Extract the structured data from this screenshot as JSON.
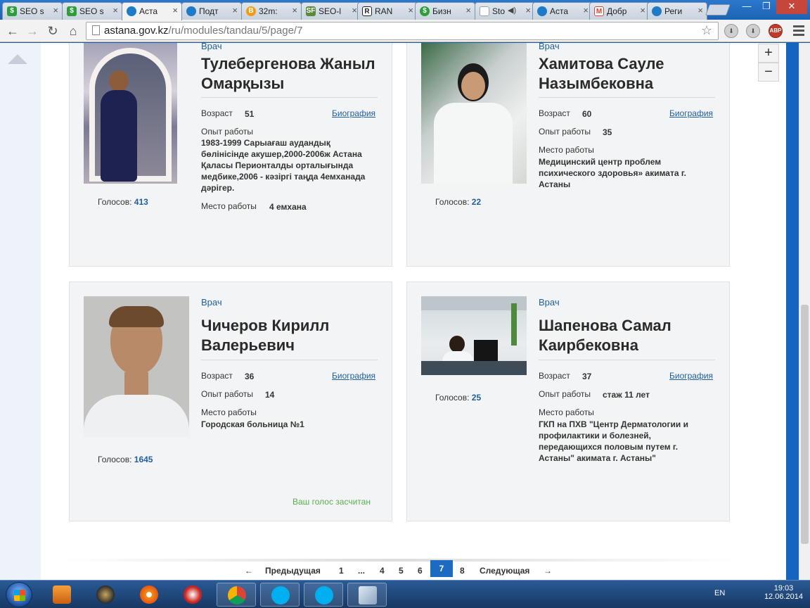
{
  "browser": {
    "tabs": [
      {
        "label": "SEO s",
        "icon": "seo-icon",
        "color": "#2e9e3a"
      },
      {
        "label": "SEO s",
        "icon": "seo-icon",
        "color": "#2e9e3a"
      },
      {
        "label": "Аста",
        "icon": "astana-emblem-icon",
        "color": "#1d7bc8",
        "active": true
      },
      {
        "label": "Подт",
        "icon": "astana-emblem-icon",
        "color": "#1d7bc8"
      },
      {
        "label": "32m:",
        "icon": "bitcoin-icon",
        "color": "#f39c12"
      },
      {
        "label": "SEO-l",
        "icon": "sf-icon",
        "color": "#5a8a3a"
      },
      {
        "label": "RAN",
        "icon": "r-icon",
        "color": "#222222"
      },
      {
        "label": "Бизн",
        "icon": "dollar-icon",
        "color": "#2e9e3a"
      },
      {
        "label": "Sto",
        "icon": "page-icon",
        "color": "#9aa3ad"
      },
      {
        "label": "Аста",
        "icon": "astana-emblem-icon",
        "color": "#1d7bc8"
      },
      {
        "label": "Добр",
        "icon": "gmail-icon",
        "color": "#d44638"
      },
      {
        "label": "Реги",
        "icon": "astana-emblem-icon",
        "color": "#1d7bc8"
      }
    ],
    "url_host": "astana.gov.kz",
    "url_path": "/ru/modules/tandau/5/page/7"
  },
  "cards": [
    {
      "role": "Врач",
      "name": "Тулебергенова Жаныл Омарқызы",
      "age_label": "Возраст",
      "age": "51",
      "bio_link": "Биография",
      "experience_label": "Опыт работы",
      "experience": "1983-1999 Сарыағаш аудандық бөлінісінде акушер,2000-2006ж Астана Қаласы Перионталды орталығында медбике,2006 - кәзіргі таңда 4емханада дәрігер.",
      "workplace_label": "Место работы",
      "workplace": "4 емхана",
      "votes_label": "Голосов:",
      "votes": "413"
    },
    {
      "role": "Врач",
      "name": "Хамитова Сауле Назымбековна",
      "age_label": "Возраст",
      "age": "60",
      "bio_link": "Биография",
      "experience_label": "Опыт работы",
      "experience": "35",
      "workplace_label": "Место работы",
      "workplace": "Медицинский центр проблем психического здоровья» акимата г. Астаны",
      "votes_label": "Голосов:",
      "votes": "22"
    },
    {
      "role": "Врач",
      "name": "Чичеров Кирилл Валерьевич",
      "age_label": "Возраст",
      "age": "36",
      "bio_link": "Биография",
      "experience_label": "Опыт работы",
      "experience": "14",
      "workplace_label": "Место работы",
      "workplace": "Городская больница №1",
      "votes_label": "Голосов:",
      "votes": "1645",
      "voted_note": "Ваш голос засчитан"
    },
    {
      "role": "Врач",
      "name": "Шапенова Самал Каирбековна",
      "age_label": "Возраст",
      "age": "37",
      "bio_link": "Биография",
      "experience_label": "Опыт работы",
      "experience": "стаж 11 лет",
      "workplace_label": "Место работы",
      "workplace": "ГКП на ПХВ \"Центр Дерматологии и профилактики и болезней, передающихся половым путем г. Астаны\" акимата г. Астаны\"",
      "votes_label": "Голосов:",
      "votes": "25"
    }
  ],
  "pagination": {
    "prev_arrow": "←",
    "prev": "Предыдущая",
    "pages": [
      "1",
      "...",
      "4",
      "5",
      "6",
      "7",
      "8"
    ],
    "current": "7",
    "next": "Следующая",
    "next_arrow": "→"
  },
  "zoom": {
    "plus": "+",
    "minus": "−"
  },
  "taskbar": {
    "language": "EN",
    "time": "19:03",
    "date": "12.06.2014"
  }
}
